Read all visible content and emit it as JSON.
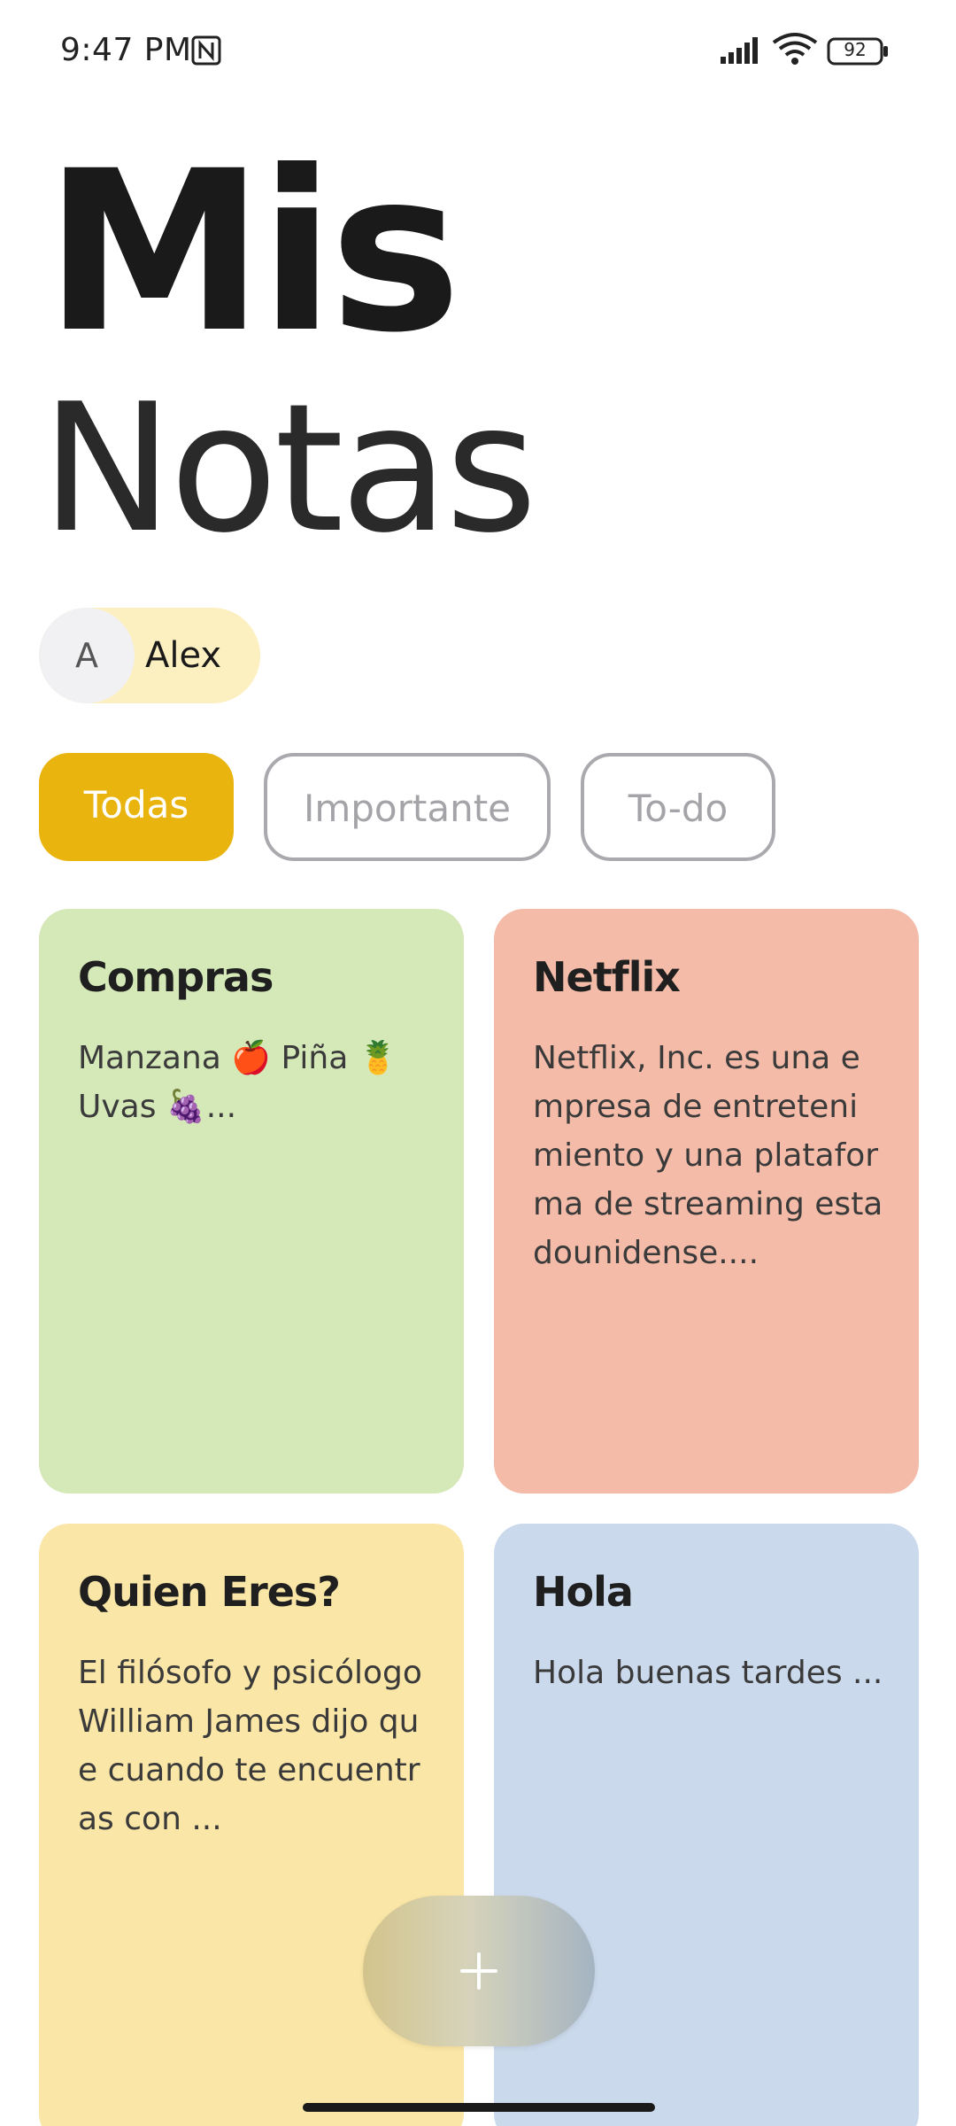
{
  "status_bar": {
    "time": "9:47 PM",
    "battery": "92",
    "icons": [
      "nfc-icon",
      "signal-icon",
      "wifi-icon",
      "battery-icon"
    ]
  },
  "header": {
    "title_line1": "Mis",
    "title_line2": "Notas"
  },
  "user": {
    "avatar_initial": "A",
    "name": "Alex"
  },
  "tabs": [
    {
      "label": "Todas",
      "selected": true
    },
    {
      "label": "Importante",
      "selected": false
    },
    {
      "label": "To-do",
      "selected": false
    }
  ],
  "notes": [
    {
      "title": "Compras",
      "body": "Manzana 🍎 Piña 🍍 Uvas 🍇...",
      "color": "#d4e8b8"
    },
    {
      "title": "Netflix",
      "body": "Netflix, Inc. es una empresa de entretenimiento y una plataforma de streaming estadounidense....",
      "color": "#f4bca8"
    },
    {
      "title": "Quien Eres?",
      "body": "El filósofo y psicólogo William James dijo que cuando te encuentras con ...",
      "color": "#fae6a6"
    },
    {
      "title": "Hola",
      "body": "Hola buenas tardes ...",
      "color": "#cbd9ec"
    }
  ],
  "fab": {
    "icon": "plus-icon"
  },
  "colors": {
    "accent": "#e9b40e",
    "user_chip": "#fcefc0",
    "tab_border": "#a9a9ae"
  }
}
